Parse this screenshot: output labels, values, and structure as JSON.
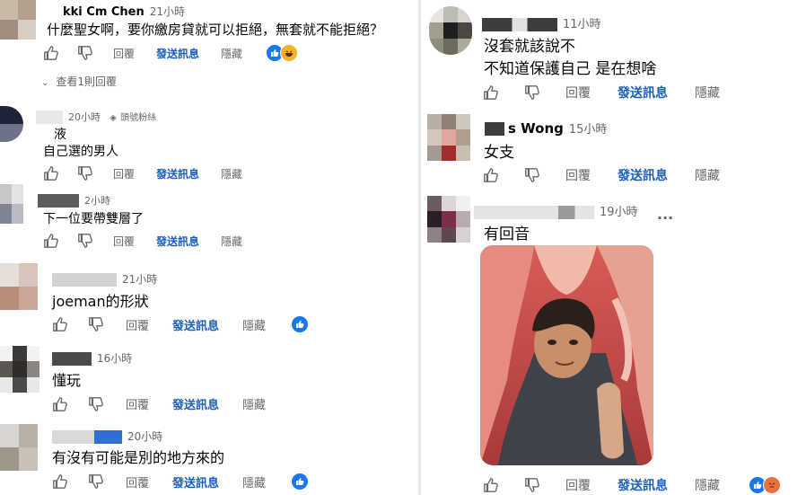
{
  "left": {
    "comments": [
      {
        "name": "kki Cm Chen",
        "time": "21小時",
        "text": "什麼聖女啊，要你繳房貸就可以拒絕，無套就不能拒絕？",
        "reactions": "like-haha"
      },
      {
        "reply_toggle": "查看1則回覆"
      },
      {
        "name": "",
        "time": "20小時",
        "badge": "頭號粉絲",
        "text_line1": "液",
        "text": "自己選的男人"
      },
      {
        "name": "",
        "time": "2小時",
        "text": "下一位要帶雙層了"
      },
      {
        "name": "",
        "time": "21小時",
        "text": "joeman的形狀",
        "reactions": "like"
      },
      {
        "name": "",
        "time": "16小時",
        "text": "懂玩"
      },
      {
        "name": "",
        "time": "20小時",
        "text": "有沒有可能是別的地方來的",
        "reactions": "like"
      }
    ]
  },
  "right": {
    "comments": [
      {
        "name": "",
        "time": "11小時",
        "text_line1": "沒套就該說不",
        "text": "不知道保護自己 是在想啥"
      },
      {
        "name": "s Wong",
        "time": "15小時",
        "text": "女支"
      },
      {
        "name": "",
        "time": "19小時",
        "text": "有回音",
        "more": "···",
        "reactions": "like-angry"
      }
    ]
  },
  "actions": {
    "reply": "回覆",
    "send_message": "發送訊息",
    "hide": "隱藏"
  },
  "colors": {
    "messenger_blue": "#1b5fbd",
    "secondary_text": "#65676b",
    "like_blue": "#1877f2"
  }
}
